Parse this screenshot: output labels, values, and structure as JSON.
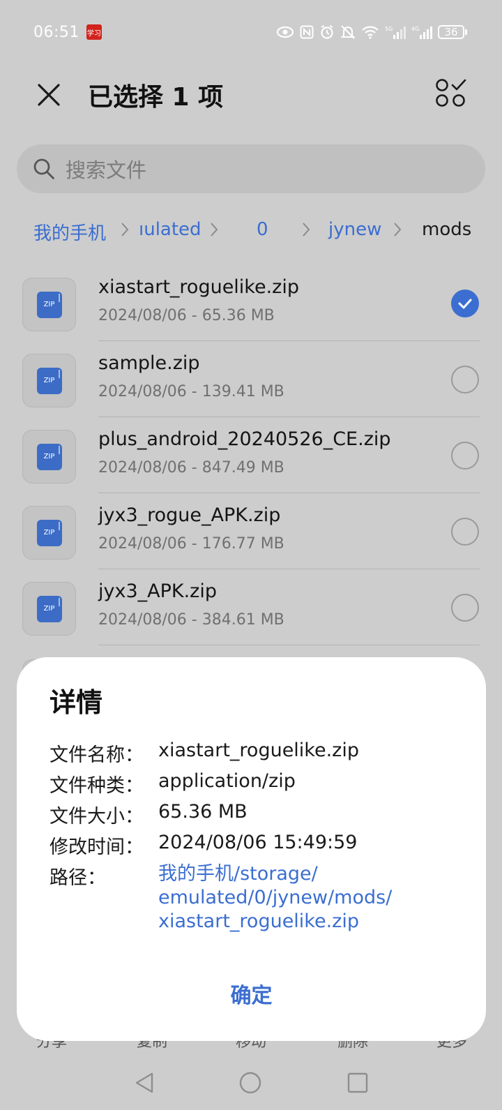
{
  "status_bar": {
    "time": "06:51",
    "badge_text": "学习",
    "network_5g": "5G",
    "network_4g": "4G",
    "battery": "36"
  },
  "header": {
    "title": "已选择 1 项"
  },
  "search": {
    "placeholder": "搜索文件"
  },
  "breadcrumb": {
    "items": [
      "我的手机",
      "ıulated",
      "0",
      "jynew",
      "mods"
    ]
  },
  "files": [
    {
      "name": "xiastart_roguelike.zip",
      "meta": "2024/08/06 - 65.36 MB",
      "checked": true,
      "icon_text": "ZIP"
    },
    {
      "name": "sample.zip",
      "meta": "2024/08/06 - 139.41 MB",
      "checked": false,
      "icon_text": "ZIP"
    },
    {
      "name": "plus_android_20240526_CE.zip",
      "meta": "2024/08/06 - 847.49 MB",
      "checked": false,
      "icon_text": "ZIP"
    },
    {
      "name": "jyx3_rogue_APK.zip",
      "meta": "2024/08/06 - 176.77 MB",
      "checked": false,
      "icon_text": "ZIP"
    },
    {
      "name": "jyx3_APK.zip",
      "meta": "2024/08/06 - 384.61 MB",
      "checked": false,
      "icon_text": "ZIP"
    }
  ],
  "bottom_toolbar": {
    "labels": [
      "分享",
      "复制",
      "移动",
      "删除",
      "更多"
    ]
  },
  "dialog": {
    "title": "详情",
    "rows": [
      {
        "label": "文件名称：",
        "value": "xiastart_roguelike.zip"
      },
      {
        "label": "文件种类：",
        "value": "application/zip"
      },
      {
        "label": "文件大小：",
        "value": "65.36 MB"
      },
      {
        "label": "修改时间：",
        "value": "2024/08/06 15:49:59"
      }
    ],
    "path_label": "路径：",
    "path_lines": [
      "我的手机/storage/",
      "emulated/0/jynew/mods/",
      "xiastart_roguelike.zip"
    ],
    "confirm": "确定"
  },
  "colors": {
    "accent": "#3b6ed0",
    "overlay_bg": "#cdcdcd",
    "dialog_bg": "#ffffff"
  }
}
